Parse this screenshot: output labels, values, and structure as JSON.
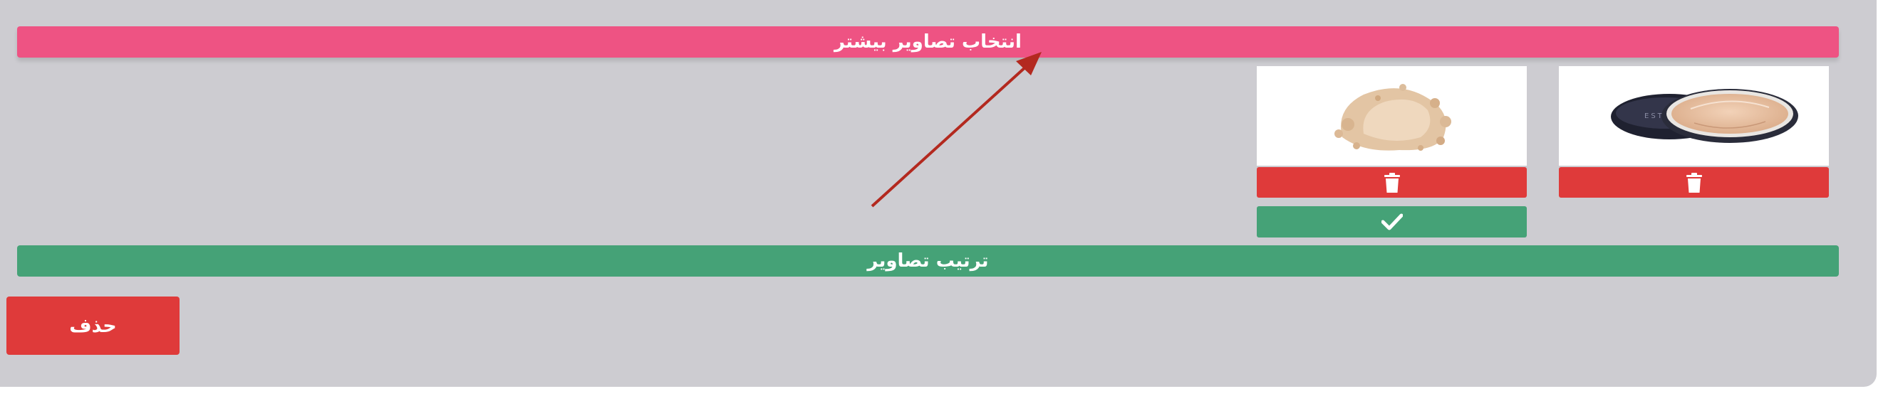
{
  "gallery": {
    "select_more_label": "انتخاب تصاویر بیشتر",
    "sort_images_label": "ترتیب تصاویر",
    "delete_label": "حذف",
    "images": [
      {
        "name": "loose-powder-jar"
      },
      {
        "name": "powder-swatch"
      }
    ]
  },
  "colors": {
    "panel": "#cdccd1",
    "pink": "#ee5383",
    "green": "#45a277",
    "red": "#df3a3a",
    "arrow": "#b3291f"
  },
  "icons": [
    "trash-icon",
    "check-icon",
    "arrow-annotation"
  ]
}
